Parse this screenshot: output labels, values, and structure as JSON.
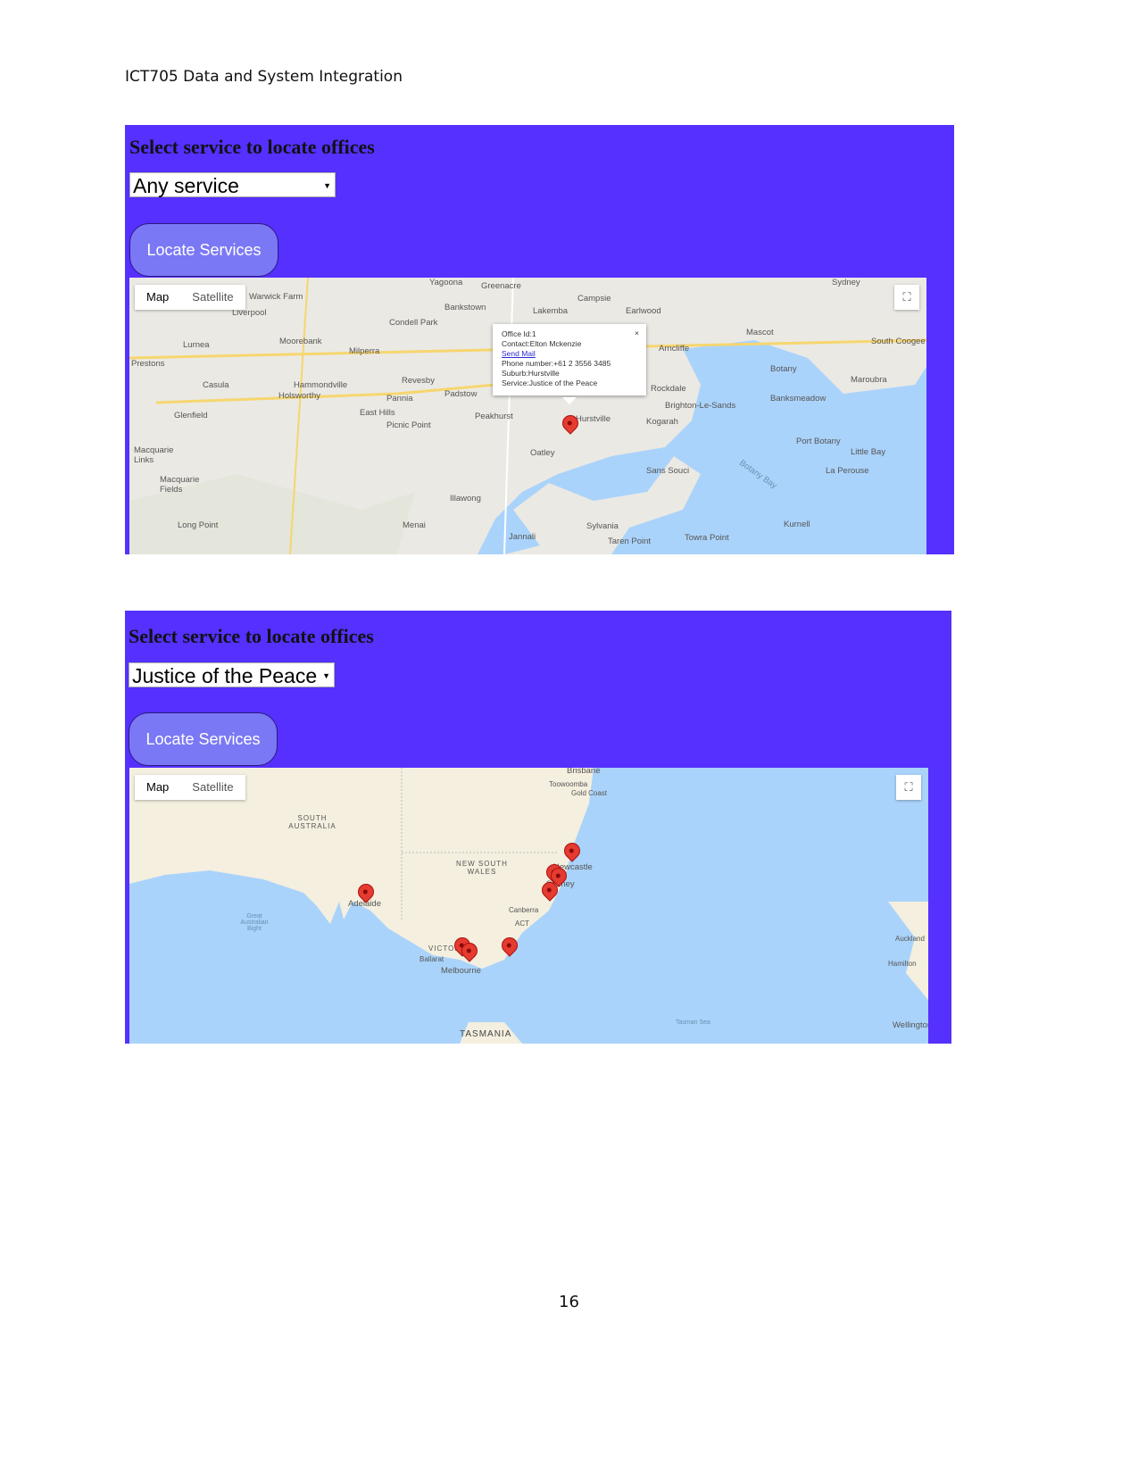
{
  "document": {
    "header": "ICT705 Data and System Integration",
    "page_number": "16"
  },
  "panels": [
    {
      "title": "Select service to locate offices",
      "select_value": "Any service",
      "button": "Locate Services",
      "map": {
        "type_map": "Map",
        "type_satellite": "Satellite",
        "labels": [
          "Yagoona",
          "Greenacre",
          "Campsie",
          "Earlwood",
          "Bankstown",
          "Lakemba",
          "Liverpool",
          "Warwick Farm",
          "Condell Park",
          "Mascot",
          "Sydney",
          "South Coogee",
          "Lurnea",
          "Moorebank",
          "Milperra",
          "Arncliffe",
          "Prestons",
          "Revesby",
          "Rockdale",
          "Botany",
          "Maroubra",
          "Casula",
          "Hammondville",
          "Holsworthy",
          "Padstow",
          "Pannia",
          "Banksmeadow",
          "Brighton-Le-Sands",
          "Glenfield",
          "East Hills",
          "Picnic Point",
          "Peakhurst",
          "Hurstville",
          "Kogarah",
          "Port Botany",
          "Little Bay",
          "Macquarie Links",
          "Oatley",
          "Sans Souci",
          "La Perouse",
          "Macquarie Fields",
          "Illawong",
          "Botany Bay",
          "Long Point",
          "Menai",
          "Jannali",
          "Sylvania",
          "Taren Point",
          "Towra Point",
          "Kurnell"
        ],
        "info_window": {
          "office_id": "Office Id:1",
          "contact": "Contact:Elton Mckenzie",
          "link": "Send Mail",
          "phone": "Phone number:+61 2 3556 3485",
          "suburb": "Suburb:Hurstville",
          "service": "Service:Justice of the Peace",
          "close": "×"
        }
      }
    },
    {
      "title": "Select service to locate offices",
      "select_value": "Justice of the Peace",
      "button": "Locate Services",
      "map": {
        "type_map": "Map",
        "type_satellite": "Satellite",
        "labels": [
          "Brisbane",
          "Toowoomba",
          "Gold Coast",
          "SOUTH AUSTRALIA",
          "NEW SOUTH WALES",
          "Newcastle",
          "Sydney",
          "Adelaide",
          "Canberra",
          "ACT",
          "Great Australian Bight",
          "VICTORIA",
          "Ballarat",
          "Melbourne",
          "Auckland",
          "Hamilton",
          "Tasman Sea",
          "Wellington",
          "TASMANIA"
        ]
      }
    }
  ],
  "colors": {
    "panel": "#5530ff",
    "button": "#7b78f5",
    "marker": "#e53b30",
    "water": "#aad3fb"
  }
}
